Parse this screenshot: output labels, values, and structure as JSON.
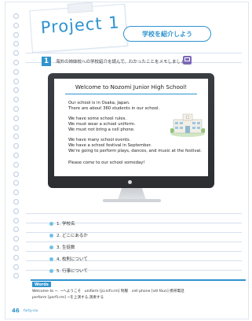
{
  "header": {
    "title": "Project 1",
    "subtitle": "学校を紹介しよう"
  },
  "task": {
    "number": "1",
    "instruction": "海外の姉妹校への学校紹介を読んで、わかったことをメモしましょう。"
  },
  "screen": {
    "heading": "Welcome to Nozomi Junior High School!",
    "paragraphs": [
      [
        "Our school is in Osaka, Japan.",
        "There are about 360 students in our school."
      ],
      [
        "We have some school rules.",
        "We must wear a school uniform.",
        "We must not bring a cell phone."
      ],
      [
        "We have many school events.",
        "We have a school festival in September.",
        "We're going to perform plays, dances, and music at the festival."
      ],
      [
        "Please come to our school someday!"
      ]
    ]
  },
  "memo": [
    "1. 学校名",
    "2. どこにあるか",
    "3. 生徒数",
    "4. 校則について",
    "5. 行事について"
  ],
  "words": {
    "tag": "Words",
    "line1": "Welcome to ~. ~へようこそ　uniform [júːnifɔːrm] 制服　cell phone [sél fóun] 携帯電話",
    "line2": "perform [pərfɔ́ːrm] ~を上演する,演奏する"
  },
  "footer": {
    "page_number": "46",
    "page_word": "forty-six"
  },
  "colors": {
    "accent": "#2f93d0",
    "memo_dot": "#6fc0e8",
    "icon": "#7b68b8"
  }
}
